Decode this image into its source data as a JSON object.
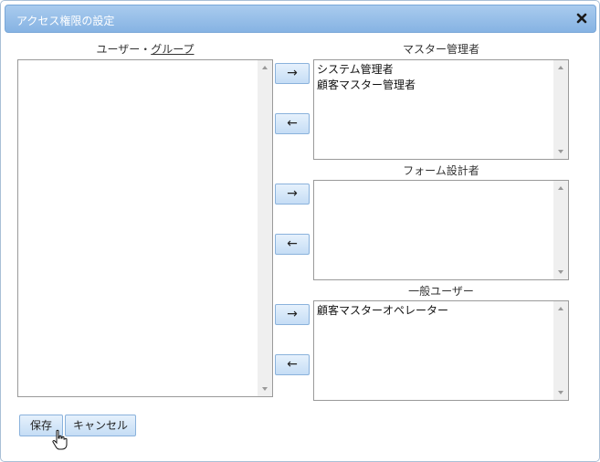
{
  "dialog": {
    "title": "アクセス権限の設定",
    "close_icon": "close-icon"
  },
  "users_groups": {
    "label_part1": "ユーザー・",
    "label_part2": "グループ",
    "items": []
  },
  "roles": [
    {
      "label": "マスター管理者",
      "items": [
        "システム管理者",
        "顧客マスター管理者"
      ]
    },
    {
      "label": "フォーム設計者",
      "items": []
    },
    {
      "label": "一般ユーザー",
      "items": [
        "顧客マスターオペレーター"
      ]
    }
  ],
  "move_buttons": {
    "add": "→",
    "remove": "←"
  },
  "footer": {
    "save_label": "保存",
    "cancel_label": "キャンセル"
  }
}
